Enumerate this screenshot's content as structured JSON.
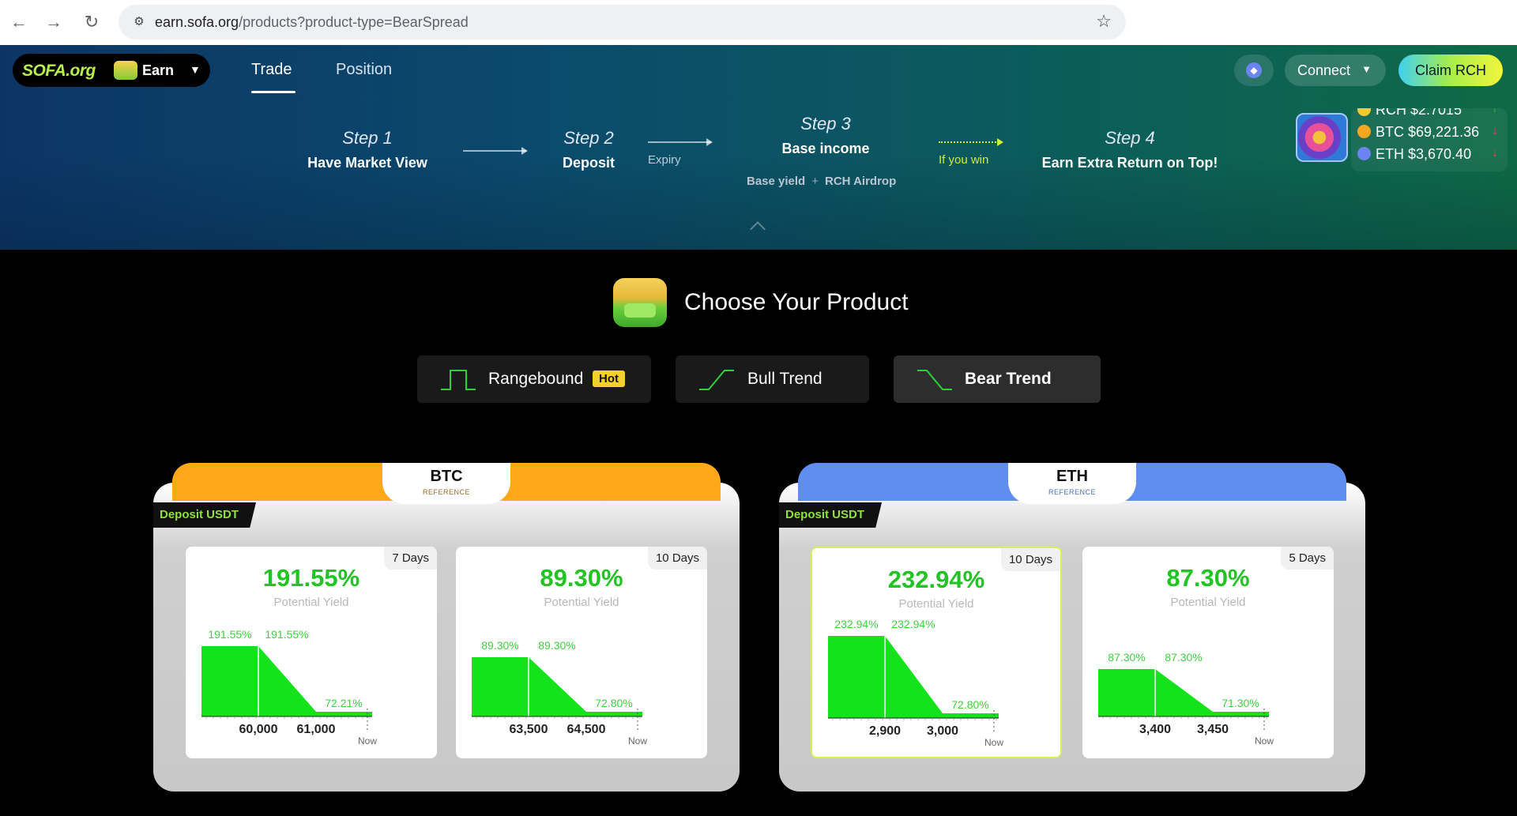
{
  "browser": {
    "url_host": "earn.sofa.org",
    "url_path": "/products?product-type=BearSpread"
  },
  "header": {
    "logo": "SOFA.org",
    "app_switch_label": "Earn",
    "tabs": [
      {
        "label": "Trade",
        "active": true
      },
      {
        "label": "Position",
        "active": false
      }
    ],
    "connect_label": "Connect",
    "claim_label": "Claim RCH"
  },
  "steps": {
    "step1": {
      "title": "Step 1",
      "desc": "Have Market View"
    },
    "step2": {
      "title": "Step 2",
      "desc": "Deposit"
    },
    "expiry_label": "Expiry",
    "step3": {
      "title": "Step 3",
      "desc": "Base income",
      "base_yield": "Base yield",
      "plus": "+",
      "airdrop": "RCH Airdrop"
    },
    "if_you_win": "If you win",
    "step4": {
      "title": "Step 4",
      "desc": "Earn Extra Return on Top!"
    }
  },
  "ticker": [
    {
      "text": "RCH $2.7015",
      "dir": "↑",
      "dir_color": "#2ed13a",
      "coin_color": "#f0c93a"
    },
    {
      "text": "BTC $69,221.36",
      "dir": "↓",
      "dir_color": "#ef4444",
      "coin_color": "#f7a823"
    },
    {
      "text": "ETH $3,670.40",
      "dir": "↓",
      "dir_color": "#ef4444",
      "coin_color": "#6b84f0"
    }
  ],
  "section_title": "Choose Your Product",
  "products": [
    {
      "label": "Rangebound",
      "badge": "Hot",
      "selected": false
    },
    {
      "label": "Bull Trend",
      "selected": false
    },
    {
      "label": "Bear Trend",
      "selected": true
    }
  ],
  "colors": {
    "accent_green": "#21c423",
    "chart_green": "#14e31b",
    "btc_orange": "#ffa81a",
    "eth_blue": "#5f8ef0"
  },
  "groups": [
    {
      "asset": "BTC",
      "reference": "REFERENCE",
      "deposit": "Deposit USDT",
      "cards": [
        {
          "days": "7 Days",
          "yield": "191.55%",
          "yield_label": "Potential Yield",
          "chart_data": {
            "type": "area",
            "max_yield": "191.55%",
            "max_yield_2": "191.55%",
            "min_yield": "72.21%",
            "strike_high": "60,000",
            "strike_low": "61,000",
            "now_label": "Now"
          }
        },
        {
          "days": "10 Days",
          "yield": "89.30%",
          "yield_label": "Potential Yield",
          "chart_data": {
            "type": "area",
            "max_yield": "89.30%",
            "max_yield_2": "89.30%",
            "min_yield": "72.80%",
            "strike_high": "63,500",
            "strike_low": "64,500",
            "now_label": "Now"
          }
        }
      ]
    },
    {
      "asset": "ETH",
      "reference": "REFERENCE",
      "deposit": "Deposit USDT",
      "cards": [
        {
          "days": "10 Days",
          "yield": "232.94%",
          "yield_label": "Potential Yield",
          "chart_data": {
            "type": "area",
            "max_yield": "232.94%",
            "max_yield_2": "232.94%",
            "min_yield": "72.80%",
            "strike_high": "2,900",
            "strike_low": "3,000",
            "now_label": "Now"
          }
        },
        {
          "days": "5 Days",
          "yield": "87.30%",
          "yield_label": "Potential Yield",
          "chart_data": {
            "type": "area",
            "max_yield": "87.30%",
            "max_yield_2": "87.30%",
            "min_yield": "71.30%",
            "strike_high": "3,400",
            "strike_low": "3,450",
            "now_label": "Now"
          }
        }
      ]
    }
  ]
}
